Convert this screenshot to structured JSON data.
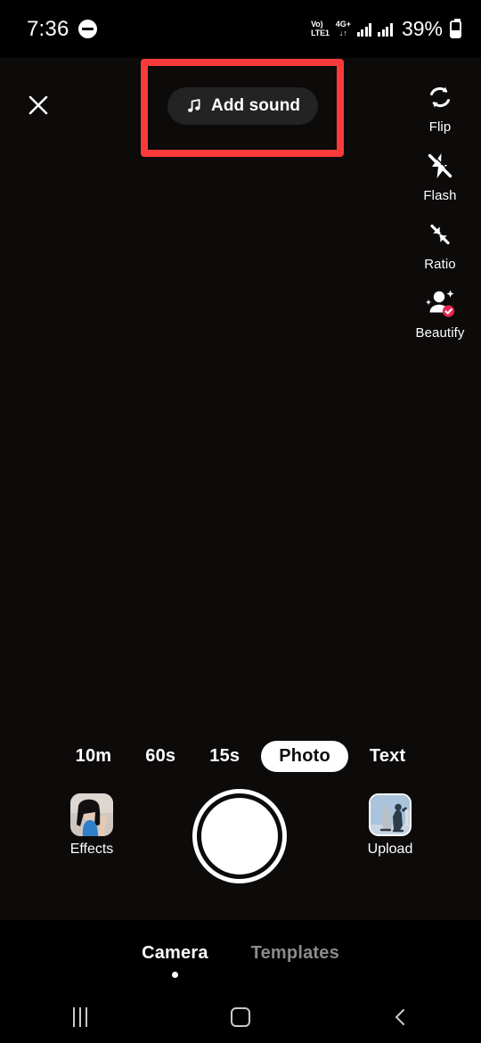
{
  "status_bar": {
    "time": "7:36",
    "dnd_icon": "do-not-disturb-icon",
    "volte_line1": "Vo)",
    "volte_line2": "LTE1",
    "network_type": "4G+",
    "data_arrows": "↓↑",
    "battery_percent": "39%",
    "battery_icon": "battery-icon"
  },
  "viewfinder": {
    "close_icon": "close-icon",
    "add_sound": {
      "label": "Add sound",
      "icon": "music-note-icon"
    },
    "annotation": {
      "color": "#FB3B3B",
      "shape": "rectangle-highlight"
    }
  },
  "tool_rail": {
    "items": [
      {
        "label": "Flip",
        "icon": "flip-camera-icon"
      },
      {
        "label": "Flash",
        "icon": "flash-off-icon"
      },
      {
        "label": "Ratio",
        "icon": "aspect-ratio-icon"
      },
      {
        "label": "Beautify",
        "icon": "beautify-icon",
        "badge": "check-badge",
        "badge_color": "#E8254F"
      }
    ]
  },
  "modes": {
    "items": [
      {
        "label": "10m",
        "active": false
      },
      {
        "label": "60s",
        "active": false
      },
      {
        "label": "15s",
        "active": false
      },
      {
        "label": "Photo",
        "active": true
      },
      {
        "label": "Text",
        "active": false
      }
    ]
  },
  "capture_row": {
    "effects": {
      "label": "Effects",
      "icon": "effects-thumbnail"
    },
    "shutter": {
      "name": "shutter-button"
    },
    "upload": {
      "label": "Upload",
      "icon": "upload-thumbnail"
    }
  },
  "tab_bar": {
    "tabs": [
      {
        "label": "Camera",
        "active": true
      },
      {
        "label": "Templates",
        "active": false
      }
    ]
  },
  "nav_bar": {
    "recents_icon": "recents-icon",
    "home_icon": "home-icon",
    "back_icon": "back-icon"
  }
}
